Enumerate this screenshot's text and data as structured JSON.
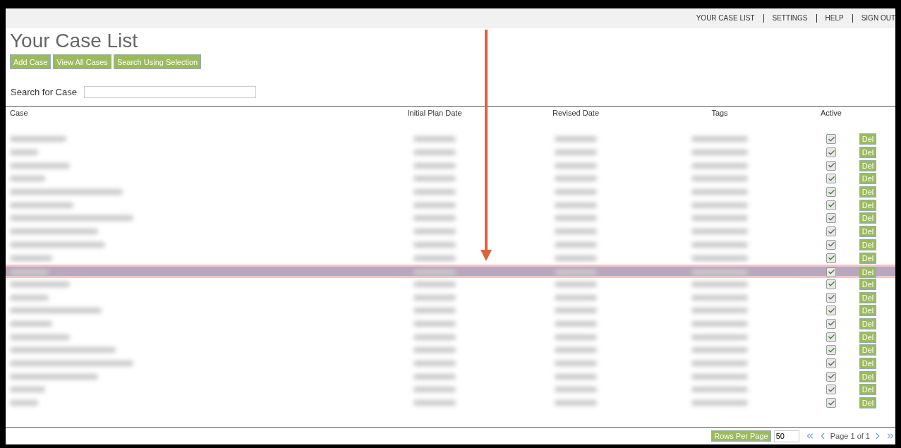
{
  "top_nav": [
    {
      "label": "YOUR CASE LIST"
    },
    {
      "label": "SETTINGS"
    },
    {
      "label": "HELP"
    },
    {
      "label": "SIGN OUT"
    }
  ],
  "title": "Your Case List",
  "actions": [
    {
      "label": "Add Case"
    },
    {
      "label": "View All Cases"
    },
    {
      "label": "Search Using Selection"
    }
  ],
  "search": {
    "label": "Search for Case"
  },
  "table": {
    "columns": [
      "Case",
      "Initial Plan Date",
      "Revised Date",
      "Tags",
      "Active"
    ],
    "rows": [
      {
        "active": true,
        "selected": false,
        "delete": "Del"
      },
      {
        "active": true,
        "selected": false,
        "delete": "Del"
      },
      {
        "active": true,
        "selected": false,
        "delete": "Del"
      },
      {
        "active": true,
        "selected": false,
        "delete": "Del"
      },
      {
        "active": true,
        "selected": false,
        "delete": "Del"
      },
      {
        "active": true,
        "selected": false,
        "delete": "Del"
      },
      {
        "active": true,
        "selected": false,
        "delete": "Del"
      },
      {
        "active": true,
        "selected": false,
        "delete": "Del"
      },
      {
        "active": true,
        "selected": false,
        "delete": "Del"
      },
      {
        "active": true,
        "selected": false,
        "delete": "Del"
      },
      {
        "active": true,
        "selected": true,
        "delete": "Del"
      },
      {
        "active": true,
        "selected": false,
        "delete": "Del"
      },
      {
        "active": true,
        "selected": false,
        "delete": "Del"
      },
      {
        "active": true,
        "selected": false,
        "delete": "Del"
      },
      {
        "active": true,
        "selected": false,
        "delete": "Del"
      },
      {
        "active": true,
        "selected": false,
        "delete": "Del"
      },
      {
        "active": true,
        "selected": false,
        "delete": "Del"
      },
      {
        "active": true,
        "selected": false,
        "delete": "Del"
      },
      {
        "active": true,
        "selected": false,
        "delete": "Del"
      },
      {
        "active": true,
        "selected": false,
        "delete": "Del"
      },
      {
        "active": true,
        "selected": false,
        "delete": "Del"
      }
    ]
  },
  "footer": {
    "rows_per_page_label": "Rows Per Page",
    "rows_per_page": "50",
    "page_text": "Page 1 of 1"
  }
}
